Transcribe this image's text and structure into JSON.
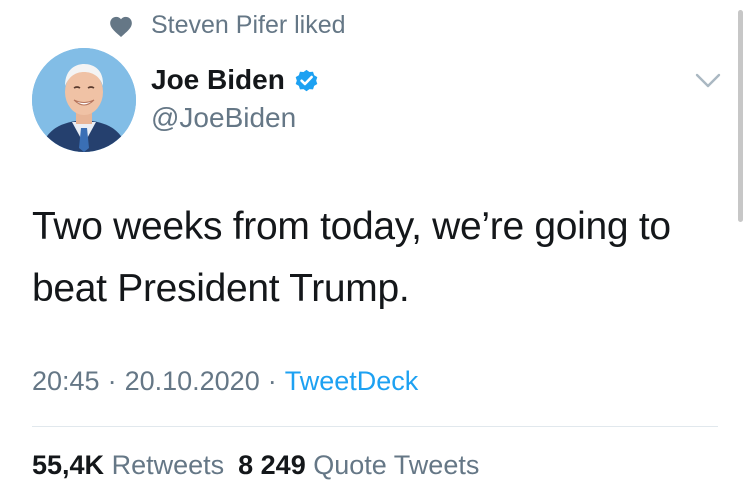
{
  "social_context": {
    "icon": "heart-icon",
    "text": "Steven Pifer liked"
  },
  "author": {
    "display_name": "Joe Biden",
    "handle": "@JoeBiden",
    "verified_icon": "verified-badge-icon",
    "avatar_icon": "avatar"
  },
  "tweet": {
    "text": "Two weeks from today, we’re going to beat President Trump."
  },
  "meta": {
    "time": "20:45",
    "separator": "·",
    "date": "20.10.2020",
    "source": "TweetDeck"
  },
  "stats": {
    "retweets_count": "55,4K",
    "retweets_label": "Retweets",
    "quotes_count": "8 249",
    "quotes_label": "Quote Tweets"
  },
  "colors": {
    "accent": "#1da1f2",
    "secondary_text": "#657786",
    "primary_text": "#14171a",
    "divider": "#e1e8ed"
  }
}
